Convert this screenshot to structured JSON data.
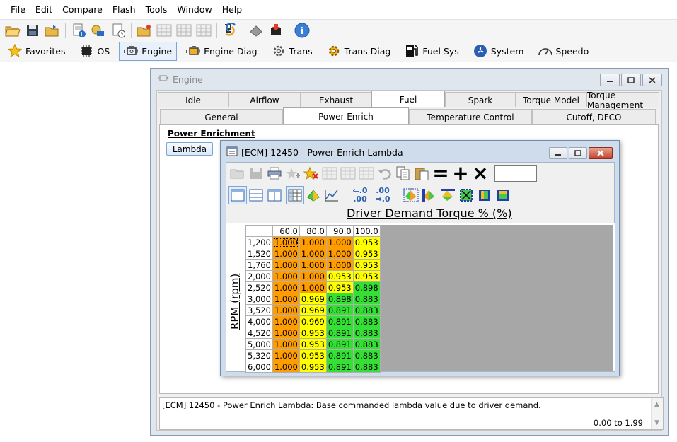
{
  "menu": [
    "File",
    "Edit",
    "Compare",
    "Flash",
    "Tools",
    "Window",
    "Help"
  ],
  "toolbar_icons": [
    "open-folder-icon",
    "save-icon",
    "open-recent-icon",
    "file-info-icon",
    "vehicle-info-icon",
    "file-history-icon",
    "new-file-icon",
    "table-icon",
    "table2-icon",
    "table3-icon",
    "checksum-icon",
    "read-chip-icon",
    "write-chip-icon",
    "about-icon"
  ],
  "modules": [
    {
      "label": "Favorites",
      "icon": "star-icon",
      "active": false
    },
    {
      "label": "OS",
      "icon": "chip-icon",
      "active": false
    },
    {
      "label": "Engine",
      "icon": "engine-icon",
      "active": true
    },
    {
      "label": "Engine Diag",
      "icon": "engine-diag-icon",
      "active": false
    },
    {
      "label": "Trans",
      "icon": "gear-icon",
      "active": false
    },
    {
      "label": "Trans Diag",
      "icon": "trans-diag-icon",
      "active": false
    },
    {
      "label": "Fuel Sys",
      "icon": "fuel-pump-icon",
      "active": false
    },
    {
      "label": "System",
      "icon": "fan-icon",
      "active": false
    },
    {
      "label": "Speedo",
      "icon": "speedometer-icon",
      "active": false
    }
  ],
  "engine_window": {
    "title": "Engine",
    "tabs_top": [
      "Idle",
      "Airflow",
      "Exhaust",
      "Fuel",
      "Spark",
      "Torque Model",
      "Torque Management"
    ],
    "active_top": "Fuel",
    "tabs_sub": [
      "General",
      "Power Enrich",
      "Temperature Control",
      "Cutoff, DFCO"
    ],
    "active_sub": "Power Enrich",
    "section_title": "Power Enrichment",
    "lambda_button": "Lambda",
    "status_desc": "[ECM] 12450 - Power Enrich Lambda: Base commanded lambda value due to driver demand.",
    "status_range": "0.00 to 1.99"
  },
  "table_window": {
    "title": "[ECM] 12450 - Power Enrich Lambda",
    "x_axis_title": "Driver Demand Torque % (%)",
    "y_axis_title": "RPM (rpm)",
    "ops": [
      "=",
      "+",
      "×"
    ],
    "inc_dec_labels": [
      ".0",
      ".00",
      ".00",
      ".0"
    ],
    "columns": [
      "60.0",
      "80.0",
      "90.0",
      "100.0"
    ],
    "rows": [
      "1,200",
      "1,520",
      "1,760",
      "2,000",
      "2,520",
      "3,000",
      "3,520",
      "4,000",
      "4,520",
      "5,000",
      "5,320",
      "6,000"
    ],
    "values": [
      [
        "1.000",
        "1.000",
        "1.000",
        "0.953"
      ],
      [
        "1.000",
        "1.000",
        "1.000",
        "0.953"
      ],
      [
        "1.000",
        "1.000",
        "1.000",
        "0.953"
      ],
      [
        "1.000",
        "1.000",
        "0.953",
        "0.953"
      ],
      [
        "1.000",
        "1.000",
        "0.953",
        "0.898"
      ],
      [
        "1.000",
        "0.969",
        "0.898",
        "0.883"
      ],
      [
        "1.000",
        "0.969",
        "0.891",
        "0.883"
      ],
      [
        "1.000",
        "0.969",
        "0.891",
        "0.883"
      ],
      [
        "1.000",
        "0.953",
        "0.891",
        "0.883"
      ],
      [
        "1.000",
        "0.953",
        "0.891",
        "0.883"
      ],
      [
        "1.000",
        "0.953",
        "0.891",
        "0.883"
      ],
      [
        "1.000",
        "0.953",
        "0.891",
        "0.883"
      ]
    ],
    "colors": {
      "high": "#ff9c00",
      "mid": "#ffff00",
      "low": "#35e035"
    }
  }
}
